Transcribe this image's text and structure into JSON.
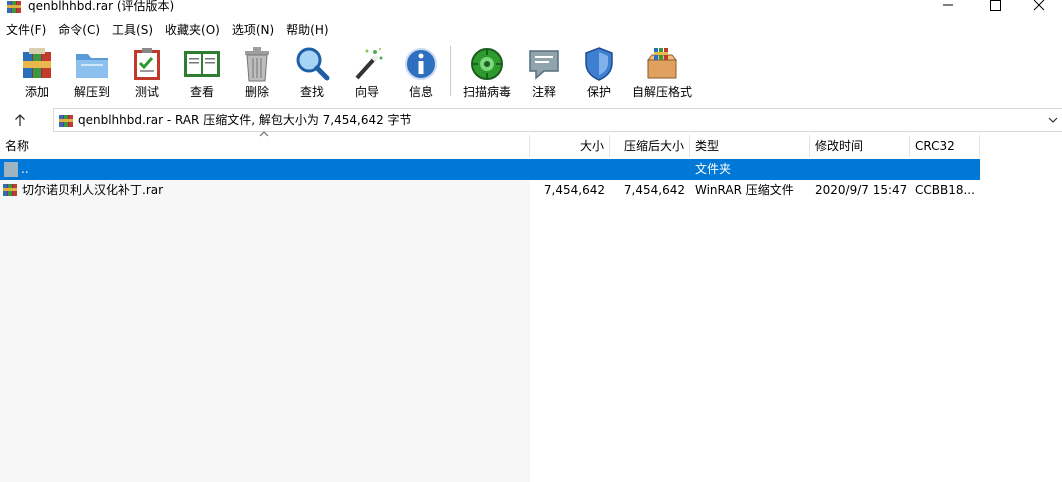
{
  "window": {
    "title": "qenblhhbd.rar (评估版本)"
  },
  "menu": [
    "文件(F)",
    "命令(C)",
    "工具(S)",
    "收藏夹(O)",
    "选项(N)",
    "帮助(H)"
  ],
  "toolbar": [
    {
      "label": "添加",
      "icon": "add-archive-icon"
    },
    {
      "label": "解压到",
      "icon": "extract-to-icon"
    },
    {
      "label": "测试",
      "icon": "test-icon"
    },
    {
      "label": "查看",
      "icon": "view-icon"
    },
    {
      "label": "删除",
      "icon": "delete-icon"
    },
    {
      "label": "查找",
      "icon": "find-icon"
    },
    {
      "label": "向导",
      "icon": "wizard-icon"
    },
    {
      "label": "信息",
      "icon": "info-icon"
    },
    {
      "label": "扫描病毒",
      "icon": "virus-scan-icon"
    },
    {
      "label": "注释",
      "icon": "comment-icon"
    },
    {
      "label": "保护",
      "icon": "protect-icon"
    },
    {
      "label": "自解压格式",
      "icon": "sfx-icon"
    }
  ],
  "address": {
    "text": "qenblhhbd.rar - RAR 压缩文件, 解包大小为 7,454,642 字节"
  },
  "columns": {
    "name": "名称",
    "size": "大小",
    "packed": "压缩后大小",
    "type": "类型",
    "modified": "修改时间",
    "crc": "CRC32"
  },
  "rows": [
    {
      "name": "..",
      "size": "",
      "packed": "",
      "type": "文件夹",
      "modified": "",
      "crc": ""
    },
    {
      "name": "切尔诺贝利人汉化补丁.rar",
      "size": "7,454,642",
      "packed": "7,454,642",
      "type": "WinRAR 压缩文件",
      "modified": "2020/9/7 15:47",
      "crc": "CCBB18..."
    }
  ],
  "colors": {
    "selection": "#0078d7"
  }
}
